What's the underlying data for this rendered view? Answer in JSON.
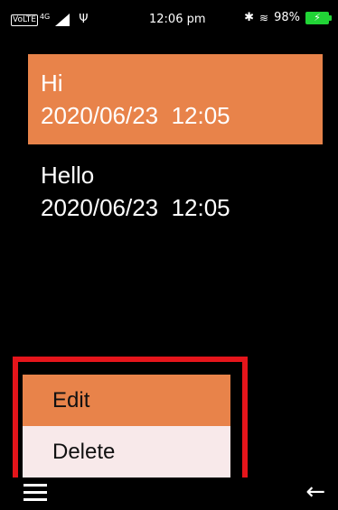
{
  "status_bar": {
    "volte": "VoLTE",
    "network": "4G",
    "signal_icon": "signal-icon",
    "usb_icon": "usb-icon",
    "usb_glyph": "Ψ",
    "time": "12:06 pm",
    "bluetooth_glyph": "✱",
    "wifi_glyph": "≋",
    "battery_percent": "98%",
    "battery_color": "#21d436"
  },
  "notes": [
    {
      "title": "Hi",
      "date": "2020/06/23  12:05",
      "selected": true
    },
    {
      "title": "Hello",
      "date": "2020/06/23  12:05",
      "selected": false
    }
  ],
  "menu": {
    "items": [
      {
        "label": "Edit",
        "focused": true
      },
      {
        "label": "Delete",
        "focused": false
      }
    ],
    "highlight_color": "#e5151b"
  },
  "softkeys": {
    "left_icon": "menu-icon",
    "right_icon": "back-arrow-icon",
    "right_glyph": "←"
  },
  "colors": {
    "accent": "#e8834a",
    "menu_item_bg": "#f8e9ea",
    "background": "#000000"
  }
}
